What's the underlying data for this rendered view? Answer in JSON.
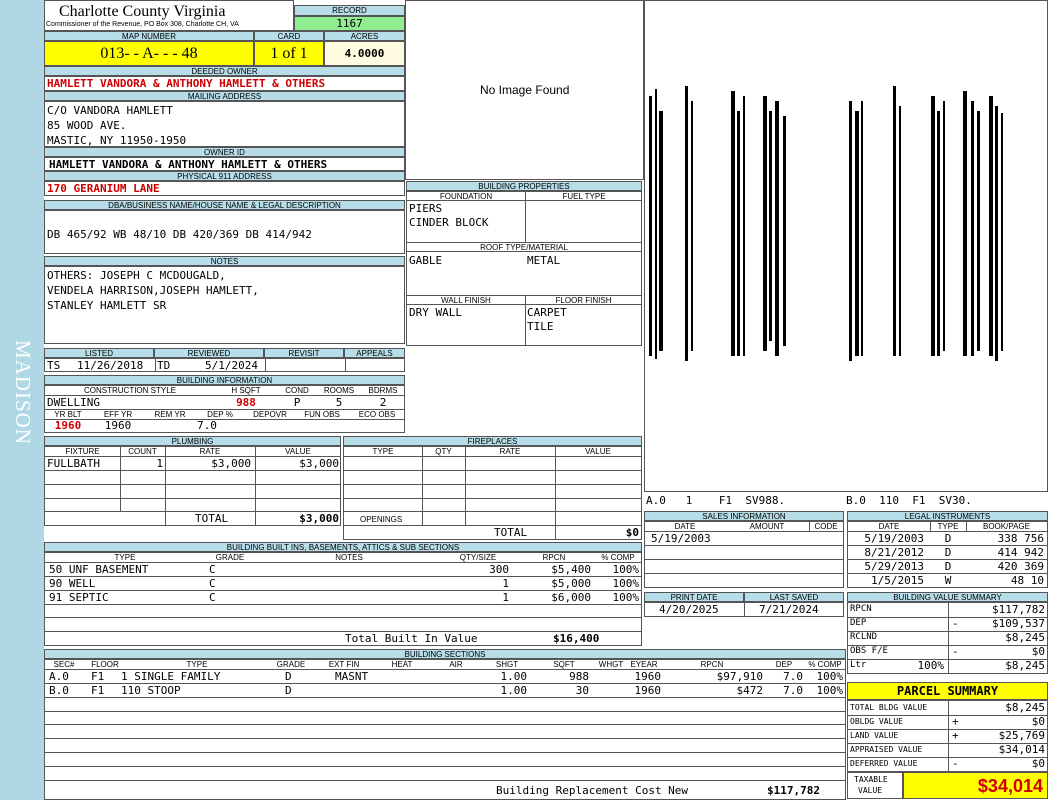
{
  "header": {
    "county": "Charlotte County Virginia",
    "office": "Commissioner of the Revenue, PO Box 308, Charlotte CH, VA",
    "record_label": "RECORD",
    "record": "1167",
    "map_label": "MAP NUMBER",
    "map_number": "013- - A- - - 48",
    "card_label": "CARD",
    "card": "1 of 1",
    "acres_label": "ACRES",
    "acres": "4.0000"
  },
  "owner": {
    "deeded_label": "DEEDED OWNER",
    "deeded": "HAMLETT VANDORA & ANTHONY HAMLETT & OTHERS",
    "mailing_label": "MAILING ADDRESS",
    "mail1": "C/O VANDORA HAMLETT",
    "mail2": "85 WOOD AVE.",
    "mail3": "MASTIC, NY 11950-1950",
    "ownerid_label": "OWNER ID",
    "ownerid": "HAMLETT VANDORA & ANTHONY HAMLETT & OTHERS",
    "phys_label": "PHYSICAL 911 ADDRESS",
    "phys": "170 GERANIUM LANE"
  },
  "legal": {
    "label": "DBA/BUSINESS NAME/HOUSE NAME & LEGAL DESCRIPTION",
    "text": "DB 465/92 WB 48/10 DB 420/369 DB 414/942"
  },
  "notes": {
    "label": "NOTES",
    "l1": "OTHERS: JOSEPH C MCDOUGALD,",
    "l2": "VENDELA HARRISON,JOSEPH HAMLETT,",
    "l3": "STANLEY HAMLETT SR"
  },
  "image": {
    "text": "No Image Found"
  },
  "sketch": {
    "left": "A.0   1    F1  SV988.",
    "right": "B.0  110  F1  SV30."
  },
  "sidebar": {
    "district": "MADISON"
  },
  "listed": {
    "listed_label": "LISTED",
    "reviewed_label": "REVIEWED",
    "revisit_label": "REVISIT",
    "appeals_label": "APPEALS",
    "listed_by": "TS",
    "listed_date": "11/26/2018",
    "reviewed_by": "TD",
    "reviewed_date": "5/1/2024"
  },
  "bldginfo": {
    "label": "BUILDING INFORMATION",
    "cs_label": "CONSTRUCTION STYLE",
    "hsqft_label": "H SQFT",
    "cond_label": "COND",
    "rooms_label": "ROOMS",
    "bdrms_label": "BDRMS",
    "style": "DWELLING",
    "hsqft": "988",
    "cond": "P",
    "rooms": "5",
    "bdrms": "2",
    "yrblt_label": "YR BLT",
    "effyr_label": "EFF YR",
    "remyr_label": "REM YR",
    "dep_label": "DEP %",
    "depovr_label": "DEPOVR",
    "funobs_label": "FUN OBS",
    "ecoobs_label": "ECO OBS",
    "yrblt": "1960",
    "effyr": "1960",
    "dep": "7.0"
  },
  "bprops": {
    "label": "BUILDING PROPERTIES",
    "found_label": "FOUNDATION",
    "fuel_label": "FUEL TYPE",
    "found1": "PIERS",
    "found2": "CINDER BLOCK",
    "roof_label": "ROOF TYPE/MATERIAL",
    "roof_type": "GABLE",
    "roof_mat": "METAL",
    "wall_label": "WALL FINISH",
    "floor_label": "FLOOR FINISH",
    "wall": "DRY WALL",
    "floor1": "CARPET",
    "floor2": "TILE"
  },
  "plumbing": {
    "label": "PLUMBING",
    "h_fixture": "FIXTURE",
    "h_count": "COUNT",
    "h_rate": "RATE",
    "h_value": "VALUE",
    "fixture": "FULLBATH",
    "count": "1",
    "rate": "$3,000",
    "value": "$3,000",
    "total_label": "TOTAL",
    "total": "$3,000"
  },
  "fireplaces": {
    "label": "FIREPLACES",
    "h_type": "TYPE",
    "h_qty": "QTY",
    "h_rate": "RATE",
    "h_value": "VALUE",
    "openings": "OPENINGS",
    "total_label": "TOTAL",
    "total": "$0"
  },
  "sales": {
    "label": "SALES INFORMATION",
    "h_date": "DATE",
    "h_amount": "AMOUNT",
    "h_code": "CODE",
    "date": "5/19/2003"
  },
  "legalinst": {
    "label": "LEGAL INSTRUMENTS",
    "h_date": "DATE",
    "h_type": "TYPE",
    "h_book": "BOOK/PAGE",
    "rows": [
      [
        "5/19/2003",
        "D",
        "338 756"
      ],
      [
        "8/21/2012",
        "D",
        "414 942"
      ],
      [
        "5/29/2013",
        "D",
        "420 369"
      ],
      [
        "1/5/2015",
        "W",
        "48 10"
      ]
    ]
  },
  "printinfo": {
    "print_label": "PRINT DATE",
    "saved_label": "LAST SAVED",
    "print": "4/20/2025",
    "saved": "7/21/2024"
  },
  "builtins": {
    "label": "BUILDING BUILT INS, BASEMENTS, ATTICS & SUB SECTIONS",
    "h_type": "TYPE",
    "h_grade": "GRADE",
    "h_notes": "NOTES",
    "h_qty": "QTY/SIZE",
    "h_rpcn": "RPCN",
    "h_comp": "% COMP",
    "rows": [
      [
        "50 UNF BASEMENT",
        "C",
        "300",
        "$5,400",
        "100%"
      ],
      [
        "90 WELL",
        "C",
        "1",
        "$5,000",
        "100%"
      ],
      [
        "91 SEPTIC",
        "C",
        "1",
        "$6,000",
        "100%"
      ]
    ],
    "total_label": "Total Built In Value",
    "total": "$16,400"
  },
  "sections": {
    "label": "BUILDING SECTIONS",
    "headers": [
      "SEC#",
      "FLOOR",
      "TYPE",
      "GRADE",
      "EXT FIN",
      "HEAT",
      "AIR",
      "SHGT",
      "SQFT",
      "WHGT",
      "EYEAR",
      "RPCN",
      "DEP",
      "% COMP"
    ],
    "rows": [
      [
        "A.0",
        "F1",
        "1 SINGLE FAMILY",
        "D",
        "MASNT",
        "",
        "",
        "1.00",
        "988",
        "",
        "1960",
        "$97,910",
        "7.0",
        "100%"
      ],
      [
        "B.0",
        "F1",
        "110 STOOP",
        "D",
        "",
        "",
        "",
        "1.00",
        "30",
        "",
        "1960",
        "$472",
        "7.0",
        "100%"
      ]
    ],
    "brcn_label": "Building Replacement Cost New",
    "brcn": "$117,782"
  },
  "valsum": {
    "label": "BUILDING VALUE SUMMARY",
    "rpcn_label": "RPCN",
    "rpcn": "$117,782",
    "dep_label": "DEP",
    "dep_sign": "-",
    "dep": "$109,537",
    "rclnd_label": "RCLND",
    "rclnd": "$8,245",
    "obs_label": "OBS F/E",
    "obs_sign": "-",
    "obs": "$0",
    "ltr_label": "Ltr",
    "ltr_pct": "100%",
    "ltr": "$8,245"
  },
  "parcel": {
    "label": "PARCEL SUMMARY",
    "tbv_label": "TOTAL BLDG VALUE",
    "tbv": "$8,245",
    "obldg_label": "OBLDG VALUE",
    "obldg_sign": "+",
    "obldg": "$0",
    "land_label": "LAND VALUE",
    "land_sign": "+",
    "land": "$25,769",
    "appr_label": "APPRAISED VALUE",
    "appr": "$34,014",
    "def_label": "DEFERRED VALUE",
    "def_sign": "-",
    "def": "$0",
    "tax_label1": "TAXABLE",
    "tax_label2": "VALUE",
    "tax": "$34,014"
  }
}
